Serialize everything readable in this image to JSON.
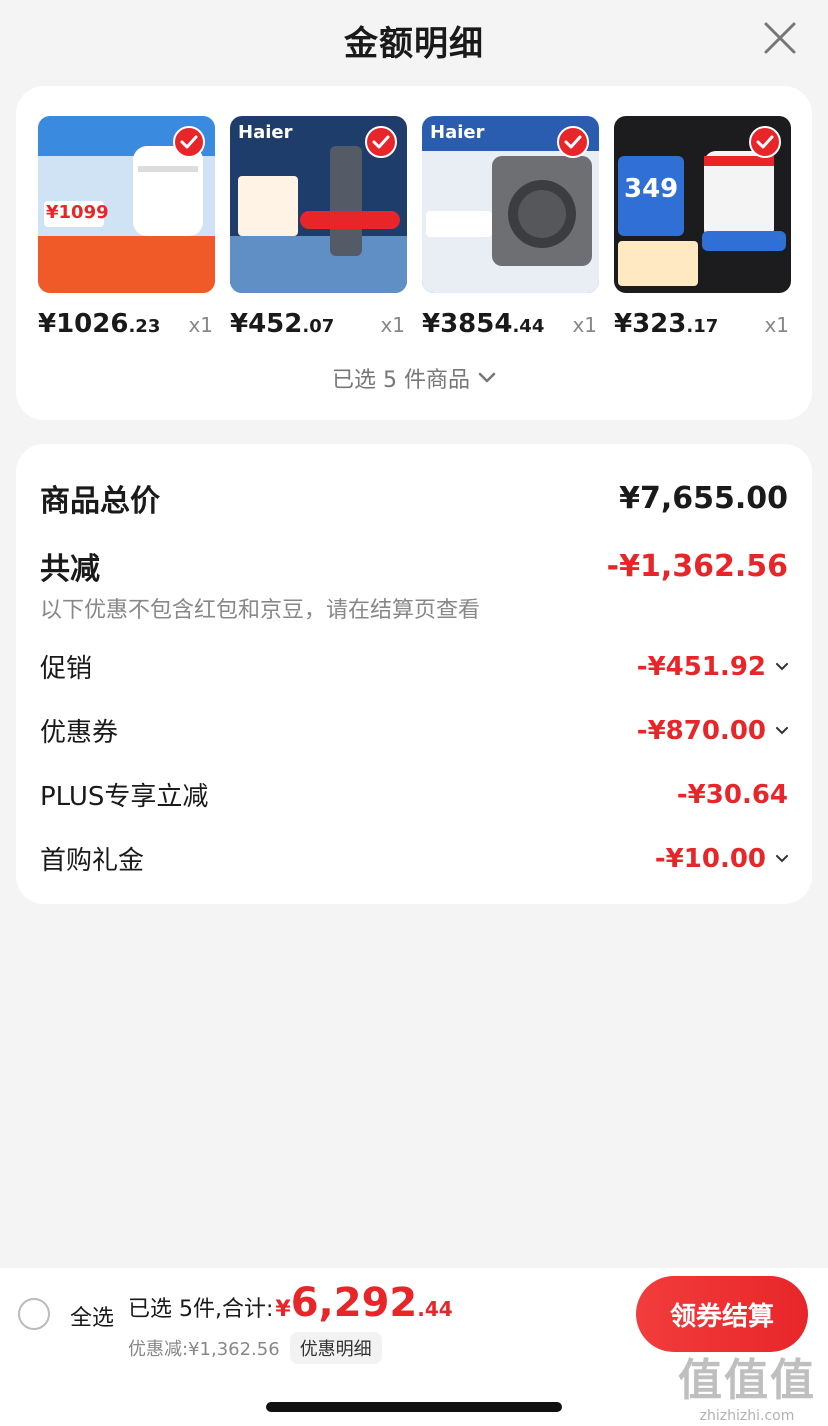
{
  "header": {
    "title": "金额明细"
  },
  "products": [
    {
      "price_int": "¥1026",
      "price_dec": ".23",
      "qty": "x1",
      "thumb_label": "¥1099"
    },
    {
      "price_int": "¥452",
      "price_dec": ".07",
      "qty": "x1",
      "thumb_label": "Haier"
    },
    {
      "price_int": "¥3854",
      "price_dec": ".44",
      "qty": "x1",
      "thumb_label": "Haier"
    },
    {
      "price_int": "¥323",
      "price_dec": ".17",
      "qty": "x1",
      "thumb_label": "349"
    }
  ],
  "selected_summary": "已选 5 件商品",
  "breakdown": {
    "total_label": "商品总价",
    "total_value": "¥7,655.00",
    "reduce_label": "共减",
    "reduce_value": "-¥1,362.56",
    "note": "以下优惠不包含红包和京豆，请在结算页查看",
    "items": [
      {
        "label": "促销",
        "value": "-¥451.92",
        "expandable": true
      },
      {
        "label": "优惠券",
        "value": "-¥870.00",
        "expandable": true
      },
      {
        "label": "PLUS专享立减",
        "value": "-¥30.64",
        "expandable": false
      },
      {
        "label": "首购礼金",
        "value": "-¥10.00",
        "expandable": true
      }
    ]
  },
  "bottom": {
    "select_all": "全选",
    "sum_label": "已选 5件,合计:",
    "sum_currency": "¥",
    "sum_int": "6,292",
    "sum_dec": ".44",
    "discount_text": "优惠减:¥1,362.56",
    "detail_chip": "优惠明细",
    "checkout": "领券结算"
  },
  "watermark": {
    "logo": "值值值",
    "url": "zhizhizhi.com"
  },
  "colors": {
    "accent": "#e8262a",
    "background": "#f4f4f4"
  }
}
